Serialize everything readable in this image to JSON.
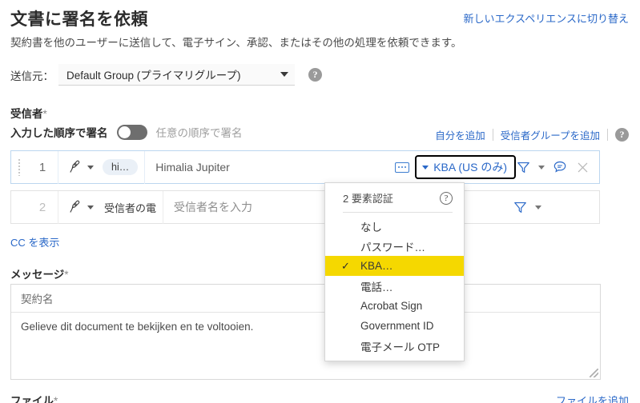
{
  "header": {
    "title": "文書に署名を依頼",
    "switch_link": "新しいエクスペリエンスに切り替え",
    "subtitle": "契約書を他のユーザーに送信して、電子サイン、承認、またはその他の処理を依頼できます。"
  },
  "sender": {
    "label": "送信元：",
    "value": "Default Group (プライマリグループ)",
    "help_glyph": "?"
  },
  "recipients": {
    "section_label": "受信者",
    "required_mark": "*",
    "order_on_label": "入力した順序で署名",
    "order_off_label": "任意の順序で署名",
    "toggle_state": "off",
    "add_me_link": "自分を追加",
    "add_group_link": "受信者グループを追加",
    "help_glyph": "?",
    "rows": [
      {
        "number": "1",
        "role_pill": "hi…",
        "role_text": "",
        "name": "Himalia Jupiter",
        "auth_label": "KBA (US のみ)",
        "focused": true
      },
      {
        "number": "2",
        "role_pill": "",
        "role_text": "受信者の電",
        "name": "受信者名を入力",
        "auth_label": "",
        "focused": false
      }
    ]
  },
  "auth_menu": {
    "header": "2 要素認証",
    "help_glyph": "?",
    "check_glyph": "✓",
    "selected": "KBA…",
    "highlight_color": "#f5d800",
    "items": [
      "なし",
      "パスワード…",
      "KBA…",
      "電話…",
      "Acrobat Sign",
      "Government ID",
      "電子メール OTP"
    ]
  },
  "cc": {
    "show_link": "CC を表示"
  },
  "message": {
    "label": "メッセージ",
    "required_mark": "*",
    "subject_placeholder": "契約名",
    "body_value": "Gelieve dit document te bekijken en te voltooien."
  },
  "files": {
    "label": "ファイル",
    "required_mark": "*",
    "add_link": "ファイルを追加"
  },
  "colors": {
    "link_blue": "#2a68c8",
    "highlight_yellow": "#f5d800",
    "row_border_blue": "#bcd6ef"
  }
}
